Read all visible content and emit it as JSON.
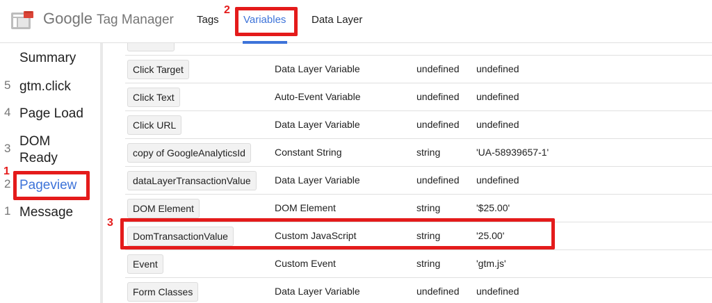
{
  "header": {
    "brand": "Google",
    "product": "Tag Manager",
    "tabs": [
      {
        "label": "Tags"
      },
      {
        "label": "Variables"
      },
      {
        "label": "Data Layer"
      }
    ]
  },
  "sidebar": {
    "items": [
      {
        "num": "",
        "label": "Summary"
      },
      {
        "num": "5",
        "label": "gtm.click"
      },
      {
        "num": "4",
        "label": "Page Load"
      },
      {
        "num": "3",
        "label": "DOM Ready"
      },
      {
        "num": "2",
        "label": "Pageview"
      },
      {
        "num": "1",
        "label": "Message"
      }
    ]
  },
  "table": {
    "rows": [
      {
        "name": "Click Target",
        "type": "Data Layer Variable",
        "vtype": "undefined",
        "value": "undefined"
      },
      {
        "name": "Click Text",
        "type": "Auto-Event Variable",
        "vtype": "undefined",
        "value": "undefined"
      },
      {
        "name": "Click URL",
        "type": "Data Layer Variable",
        "vtype": "undefined",
        "value": "undefined"
      },
      {
        "name": "copy of GoogleAnalyticsId",
        "type": "Constant String",
        "vtype": "string",
        "value": "'UA-58939657-1'"
      },
      {
        "name": "dataLayerTransactionValue",
        "type": "Data Layer Variable",
        "vtype": "undefined",
        "value": "undefined"
      },
      {
        "name": "DOM Element",
        "type": "DOM Element",
        "vtype": "string",
        "value": "'$25.00'"
      },
      {
        "name": "DomTransactionValue",
        "type": "Custom JavaScript",
        "vtype": "string",
        "value": "'25.00'"
      },
      {
        "name": "Event",
        "type": "Custom Event",
        "vtype": "string",
        "value": "'gtm.js'"
      },
      {
        "name": "Form Classes",
        "type": "Data Layer Variable",
        "vtype": "undefined",
        "value": "undefined"
      }
    ]
  },
  "annotations": {
    "one": "1",
    "two": "2",
    "three": "3"
  },
  "colors": {
    "accent": "#3d73d9",
    "annotation": "#e41b1b"
  }
}
